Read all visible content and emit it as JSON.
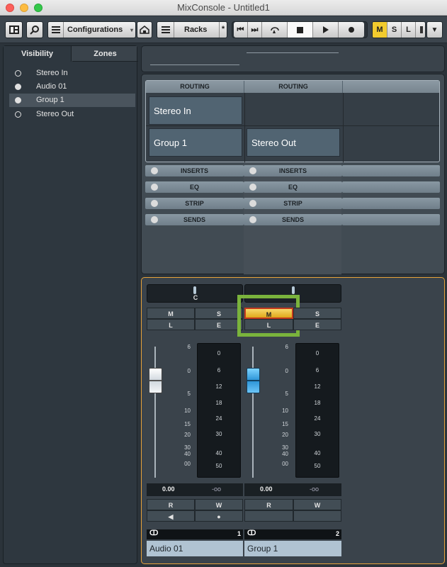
{
  "window": {
    "title": "MixConsole - Untitled1"
  },
  "toolbar": {
    "configurations": "Configurations",
    "racks": "Racks",
    "racks_star": "*",
    "m": "M",
    "s": "S",
    "l": "L"
  },
  "left_panel": {
    "tabs": [
      "Visibility",
      "Zones"
    ],
    "items": [
      "Stereo In",
      "Audio 01",
      "Group 1",
      "Stereo Out"
    ]
  },
  "racks": {
    "header": [
      "ROUTING",
      "ROUTING"
    ],
    "routing": [
      "Stereo In",
      "Group 1",
      "Stereo Out"
    ],
    "sections": [
      "INSERTS",
      "EQ",
      "STRIP",
      "SENDS"
    ]
  },
  "fader": {
    "pan_label": "C",
    "btn_m": "M",
    "btn_s": "S",
    "btn_l": "L",
    "btn_e": "E",
    "btn_r": "R",
    "btn_w": "W",
    "left_scale": [
      "6",
      "0",
      "5",
      "10",
      "15",
      "20",
      "30",
      "40",
      "00"
    ],
    "meter_scale": [
      "0",
      "6",
      "12",
      "18",
      "24",
      "30",
      "40",
      "50"
    ],
    "vol_values": [
      "0.00",
      "0.00"
    ],
    "peak_values": [
      "-oo",
      "-oo"
    ]
  },
  "channels": [
    {
      "name": "Audio 01",
      "number": "1"
    },
    {
      "name": "Group 1",
      "number": "2"
    }
  ]
}
